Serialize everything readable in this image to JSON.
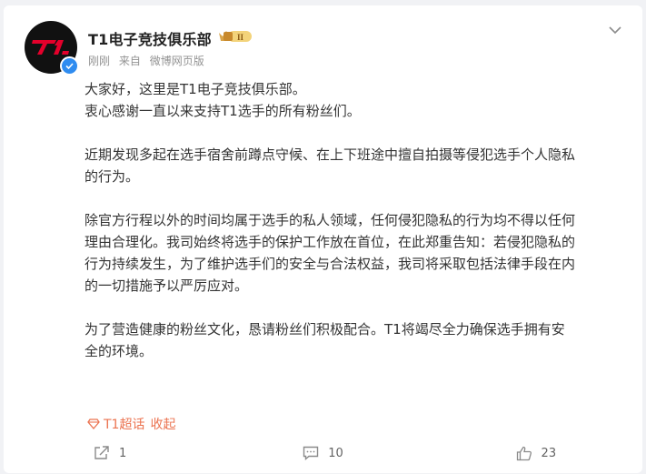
{
  "post": {
    "author": "T1电子竞技俱乐部",
    "vip_level": "II",
    "time": "刚刚",
    "source_prefix": "来自",
    "source": "微博网页版",
    "paragraphs": [
      "大家好，这里是T1电子竞技俱乐部。\n衷心感谢一直以来支持T1选手的所有粉丝们。",
      "近期发现多起在选手宿舍前蹲点守候、在上下班途中擅自拍摄等侵犯选手个人隐私\n的行为。",
      "除官方行程以外的时间均属于选手的私人领域，任何侵犯隐私的行为均不得以任何\n理由合理化。我司始终将选手的保护工作放在首位，在此郑重告知：若侵犯隐私的\n行为持续发生，为了维护选手们的安全与合法权益，我司将采取包括法律手段在内\n的一切措施予以严厉应对。",
      "为了营造健康的粉丝文化，恳请粉丝们积极配合。T1将竭尽全力确保选手拥有安\n全的环境。"
    ],
    "supertopic": "T1超话",
    "collapse": "收起"
  },
  "actions": {
    "share_count": "1",
    "comment_count": "10",
    "like_count": "23"
  },
  "colors": {
    "accent": "#eb7350",
    "verified": "#2f8cf0",
    "brand_red": "#e4002b"
  }
}
